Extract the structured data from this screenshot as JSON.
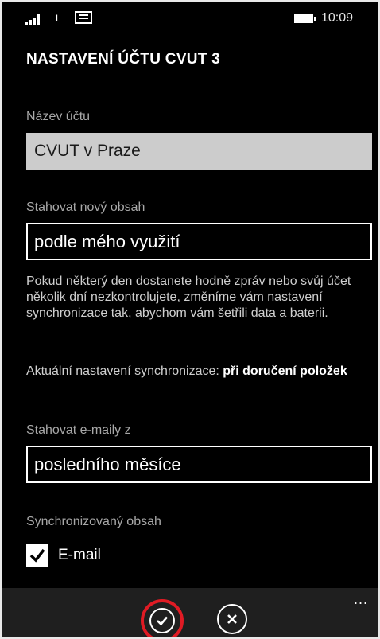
{
  "status_bar": {
    "network": "L",
    "time": "10:09"
  },
  "page_title": "NASTAVENÍ ÚČTU CVUT 3",
  "account_name": {
    "label": "Název účtu",
    "value": "CVUT v Praze"
  },
  "download_content": {
    "label": "Stahovat nový obsah",
    "value": "podle mého využití"
  },
  "info_paragraph": "Pokud některý den dostanete hodně zpráv nebo svůj účet několik dní nezkontrolujete, změníme vám nastavení synchronizace tak, abychom vám šetřili data a baterii.",
  "current_sync": {
    "label": "Aktuální nastavení synchronizace:",
    "value": "při doručení položek"
  },
  "download_emails": {
    "label": "Stahovat e-maily z",
    "value": "posledního měsíce"
  },
  "synced_content": {
    "label": "Synchronizovaný obsah",
    "email_label": "E-mail",
    "email_checked": true
  },
  "app_bar": {
    "more": "...",
    "confirm_icon": "check-icon",
    "cancel_icon": "close-icon"
  },
  "colors": {
    "background": "#000000",
    "highlight": "#e01b24",
    "field_grey": "#cccccc"
  }
}
